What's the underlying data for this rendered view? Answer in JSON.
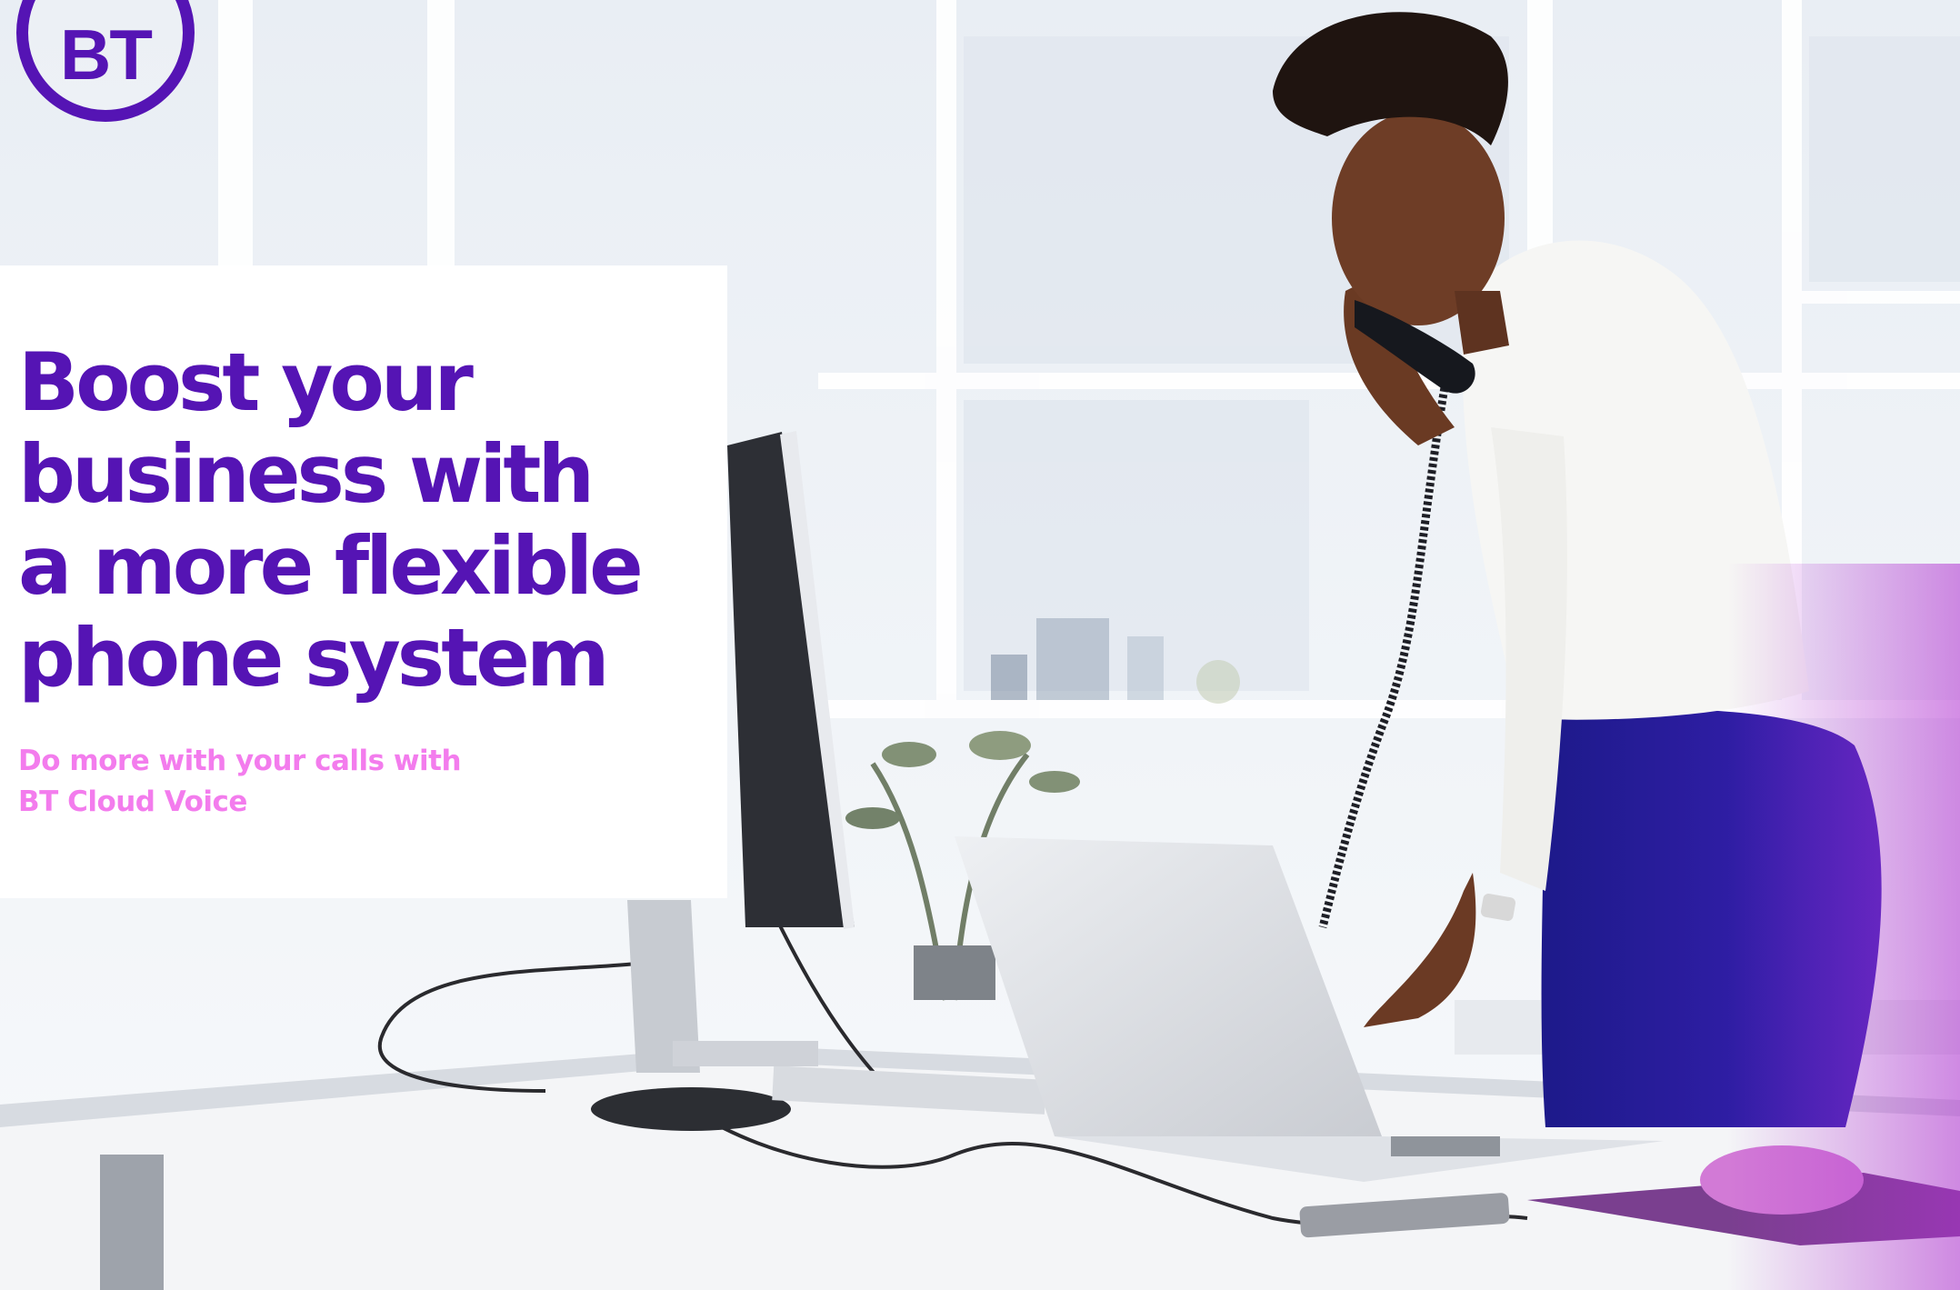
{
  "logo": {
    "text": "BT"
  },
  "hero": {
    "headline_lines": [
      "Boost your",
      "business with",
      "a more flexible",
      "phone system"
    ],
    "subhead_lines": [
      "Do more with your calls with",
      "BT Cloud Voice"
    ]
  },
  "colors": {
    "brand_purple": "#5514b4",
    "pink": "#f37ced",
    "skirt_blue": "#2d1a9e"
  },
  "photo": {
    "description_icon": "woman-on-desk-phone-at-laptop-image"
  }
}
